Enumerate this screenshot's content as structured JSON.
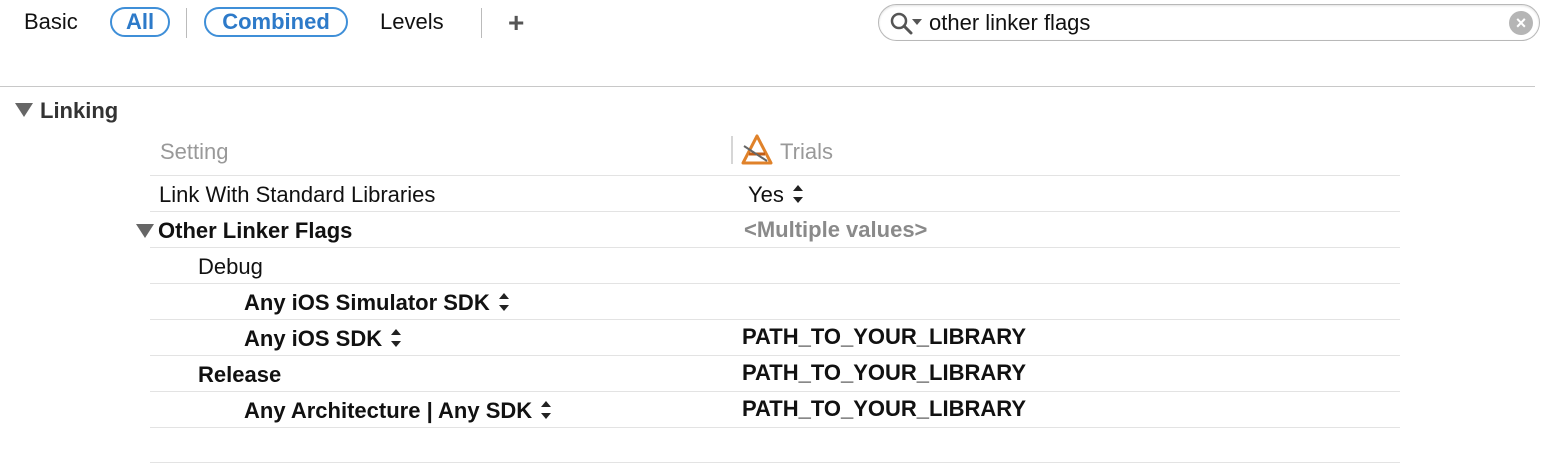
{
  "toolbar": {
    "basic": "Basic",
    "all": "All",
    "combined": "Combined",
    "levels": "Levels",
    "add": "+"
  },
  "search": {
    "value": "other linker flags",
    "clear": "×"
  },
  "section": {
    "title": "Linking"
  },
  "columns": {
    "setting": "Setting",
    "target": "Trials"
  },
  "rows": [
    {
      "label": "Link With Standard Libraries",
      "value": "Yes"
    },
    {
      "label": "Other Linker Flags",
      "value": "<Multiple values>"
    },
    {
      "label": "Debug",
      "value": ""
    },
    {
      "label": "Any iOS Simulator SDK",
      "value": ""
    },
    {
      "label": "Any iOS SDK",
      "value": "PATH_TO_YOUR_LIBRARY"
    },
    {
      "label": "Release",
      "value": "PATH_TO_YOUR_LIBRARY"
    },
    {
      "label": "Any Architecture | Any SDK",
      "value": "PATH_TO_YOUR_LIBRARY"
    }
  ],
  "colors": {
    "accent": "#3f8fd8",
    "header_text": "#999999",
    "multiple_values": "#8a8a8a"
  },
  "icons": [
    "search-icon",
    "clear-search-icon",
    "disclosure-triangle-icon",
    "app-target-icon",
    "stepper-icon"
  ]
}
